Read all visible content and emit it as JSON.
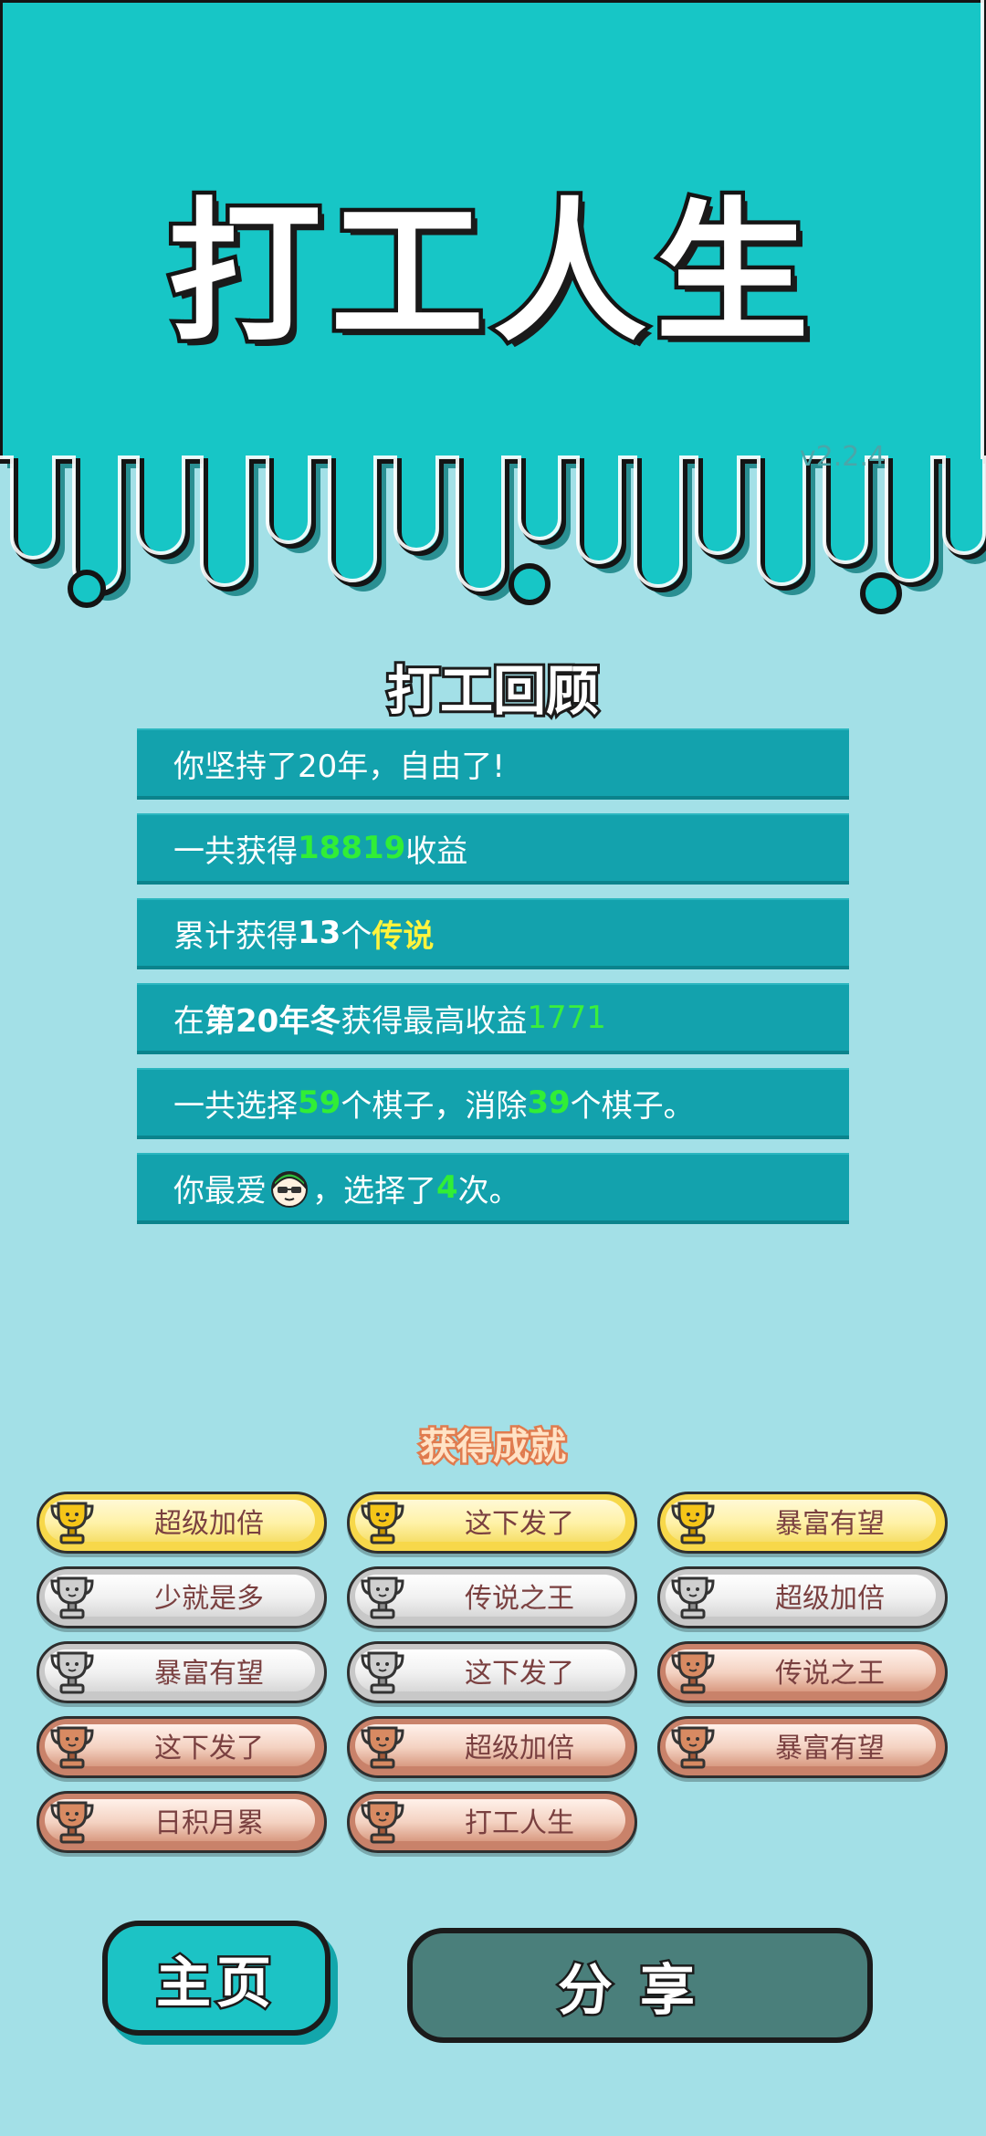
{
  "app": {
    "title": "打工人生",
    "version": "v2.2.4"
  },
  "review": {
    "title": "打工回顾",
    "stats": [
      {
        "parts": [
          {
            "t": "你坚持了20年，自由了!",
            "s": ""
          }
        ]
      },
      {
        "parts": [
          {
            "t": "一共获得",
            "s": ""
          },
          {
            "t": "18819",
            "s": "hl-green"
          },
          {
            "t": "收益",
            "s": ""
          }
        ]
      },
      {
        "parts": [
          {
            "t": "累计获得",
            "s": ""
          },
          {
            "t": "13",
            "s": "b"
          },
          {
            "t": "个",
            "s": ""
          },
          {
            "t": "传说",
            "s": "hl-yellow"
          }
        ]
      },
      {
        "parts": [
          {
            "t": "在 ",
            "s": ""
          },
          {
            "t": "第20年冬",
            "s": "b"
          },
          {
            "t": " 获得最高收益",
            "s": ""
          },
          {
            "t": "1771",
            "s": "hl-green-thin"
          }
        ]
      },
      {
        "parts": [
          {
            "t": "一共选择",
            "s": ""
          },
          {
            "t": "59",
            "s": "hl-green"
          },
          {
            "t": "个棋子，消除",
            "s": ""
          },
          {
            "t": "39",
            "s": "hl-green"
          },
          {
            "t": "个棋子。",
            "s": ""
          }
        ]
      },
      {
        "parts": [
          {
            "t": "你最爱",
            "s": ""
          },
          {
            "t": "",
            "s": "avatar"
          },
          {
            "t": "，选择了",
            "s": ""
          },
          {
            "t": "4",
            "s": "hl-green"
          },
          {
            "t": "次。",
            "s": ""
          }
        ]
      }
    ]
  },
  "achievements": {
    "title": "获得成就",
    "items": [
      {
        "label": "超级加倍",
        "tier": "gold"
      },
      {
        "label": "这下发了",
        "tier": "gold"
      },
      {
        "label": "暴富有望",
        "tier": "gold"
      },
      {
        "label": "少就是多",
        "tier": "silver"
      },
      {
        "label": "传说之王",
        "tier": "silver"
      },
      {
        "label": "超级加倍",
        "tier": "silver"
      },
      {
        "label": "暴富有望",
        "tier": "silver"
      },
      {
        "label": "这下发了",
        "tier": "silver"
      },
      {
        "label": "传说之王",
        "tier": "bronze"
      },
      {
        "label": "这下发了",
        "tier": "bronze"
      },
      {
        "label": "超级加倍",
        "tier": "bronze"
      },
      {
        "label": "暴富有望",
        "tier": "bronze"
      },
      {
        "label": "日积月累",
        "tier": "bronze"
      },
      {
        "label": "打工人生",
        "tier": "bronze"
      }
    ]
  },
  "buttons": {
    "home": "主页",
    "share": "分享"
  },
  "colors": {
    "header_teal": "#17c6c6",
    "background": "#a3e0e7",
    "stat_bar": "#13a2ad",
    "share_button": "#4a7f7b",
    "home_button": "#1cc3c5"
  }
}
